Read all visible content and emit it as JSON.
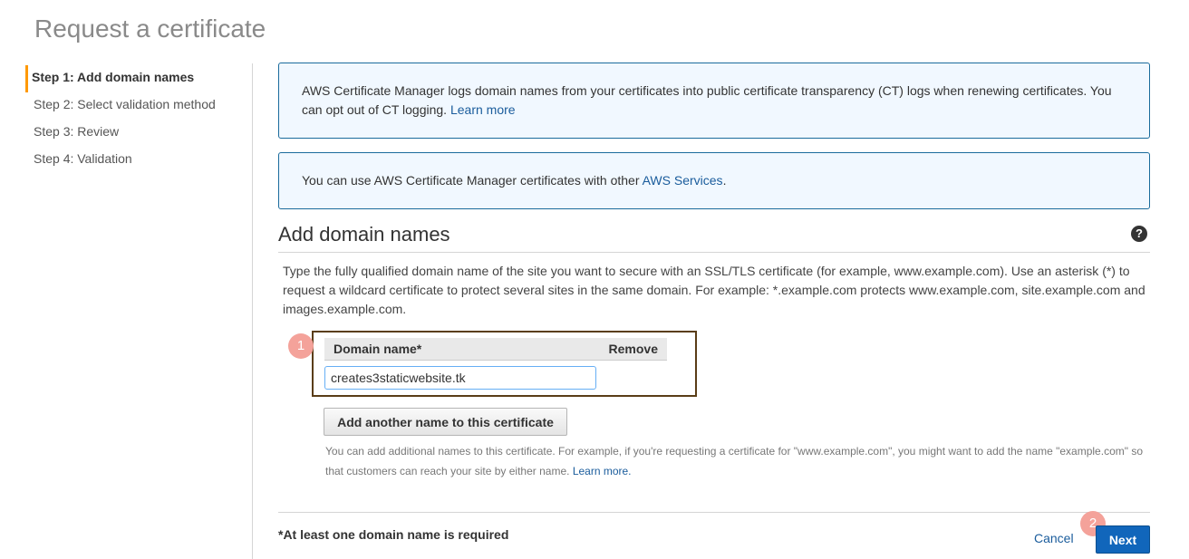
{
  "page": {
    "title": "Request a certificate"
  },
  "steps": [
    {
      "label": "Step 1: Add domain names",
      "active": true
    },
    {
      "label": "Step 2: Select validation method",
      "active": false
    },
    {
      "label": "Step 3: Review",
      "active": false
    },
    {
      "label": "Step 4: Validation",
      "active": false
    }
  ],
  "info_boxes": {
    "ct_logging": {
      "text": "AWS Certificate Manager logs domain names from your certificates into public certificate transparency (CT) logs when renewing certificates. You can opt out of CT logging.",
      "link": "Learn more"
    },
    "services": {
      "text": "You can use AWS Certificate Manager certificates with other",
      "link": "AWS Services",
      "suffix": "."
    }
  },
  "section": {
    "title": "Add domain names",
    "help_icon": "?",
    "description": "Type the fully qualified domain name of the site you want to secure with an SSL/TLS certificate (for example, www.example.com). Use an asterisk (*) to request a wildcard certificate to protect several sites in the same domain. For example: *.example.com protects www.example.com, site.example.com and images.example.com."
  },
  "domain_table": {
    "header_name": "Domain name*",
    "header_remove": "Remove",
    "value": "creates3staticwebsite.tk"
  },
  "add_button": {
    "label": "Add another name to this certificate"
  },
  "hint": {
    "text": "You can add additional names to this certificate. For example, if you're requesting a certificate for \"www.example.com\", you might want to add the name \"example.com\" so that customers can reach your site by either name.",
    "link": "Learn more."
  },
  "footer": {
    "required_note": "*At least one domain name is required",
    "cancel": "Cancel",
    "next": "Next"
  },
  "badges": {
    "first": "1",
    "second": "2"
  },
  "colors": {
    "accent": "#f90",
    "primary_button": "#1166bb",
    "link": "#1a5c9c",
    "annotation_badge": "#f4a29a"
  }
}
